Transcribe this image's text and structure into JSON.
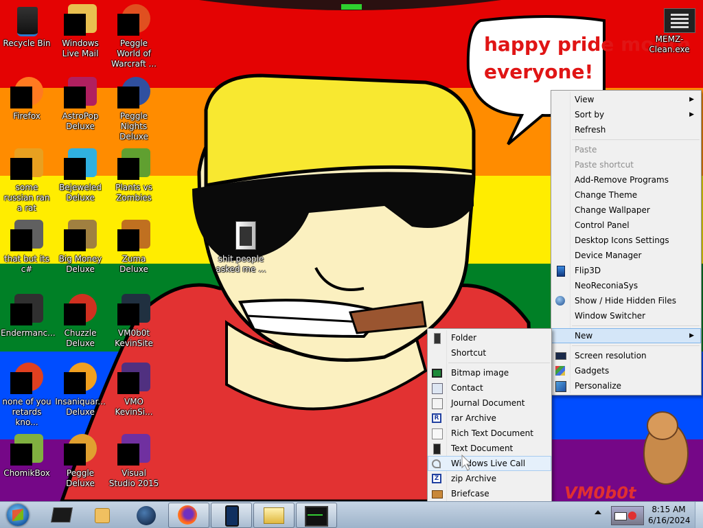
{
  "desktop": {
    "icons": [
      {
        "label": "Recycle Bin"
      },
      {
        "label": "Windows Live Mail"
      },
      {
        "label": "Peggle World of Warcraft ..."
      },
      {
        "label": "Firefox"
      },
      {
        "label": "AstroPop Deluxe"
      },
      {
        "label": "Peggle Nights Deluxe"
      },
      {
        "label": "some russian ran a rat"
      },
      {
        "label": "Bejeweled Deluxe"
      },
      {
        "label": "Plants vs Zombies"
      },
      {
        "label": "that but its c#"
      },
      {
        "label": "Big Money Deluxe"
      },
      {
        "label": "Zuma Deluxe"
      },
      {
        "label": "Endermanc..."
      },
      {
        "label": "Chuzzle Deluxe"
      },
      {
        "label": "VM0b0t KevinSite"
      },
      {
        "label": "none of you retards kno..."
      },
      {
        "label": "Insaniquar... Deluxe"
      },
      {
        "label": "VMO KevinSi..."
      },
      {
        "label": "ChomikBox"
      },
      {
        "label": "Peggle Deluxe"
      },
      {
        "label": "Visual Studio 2015"
      },
      {
        "label": "shit people asked me ..."
      },
      {
        "label": "MEMZ-Clean.exe"
      }
    ]
  },
  "wallpaper": {
    "speech_bubble": [
      "happy pride month",
      "everyone!"
    ],
    "signature": "VM0b0t",
    "colors": {
      "red": "#e40303",
      "orange": "#ff8c00",
      "yellow": "#ffed00",
      "green": "#008026",
      "blue": "#004dff",
      "purple": "#750787"
    }
  },
  "context_menu": {
    "items": [
      {
        "label": "View",
        "submenu": true
      },
      {
        "label": "Sort by",
        "submenu": true
      },
      {
        "label": "Refresh"
      },
      {
        "label": "Paste",
        "disabled": true
      },
      {
        "label": "Paste shortcut",
        "disabled": true
      },
      {
        "label": "Add-Remove Programs"
      },
      {
        "label": "Change Theme"
      },
      {
        "label": "Change Wallpaper"
      },
      {
        "label": "Control Panel"
      },
      {
        "label": "Desktop Icons Settings"
      },
      {
        "label": "Device Manager"
      },
      {
        "label": "Flip3D",
        "icon": "flip3d-icon"
      },
      {
        "label": "NeoReconiaSys"
      },
      {
        "label": "Show / Hide Hidden Files",
        "icon": "globe-icon"
      },
      {
        "label": "Window Switcher"
      },
      {
        "label": "New",
        "submenu": true
      },
      {
        "label": "Screen resolution",
        "icon": "monitor-icon"
      },
      {
        "label": "Gadgets",
        "icon": "gadgets-icon"
      },
      {
        "label": "Personalize",
        "icon": "personalize-icon"
      }
    ]
  },
  "new_submenu": {
    "items": [
      {
        "label": "Folder",
        "icon": "folder-icon"
      },
      {
        "label": "Shortcut"
      },
      {
        "label": "Bitmap image",
        "icon": "bitmap-icon"
      },
      {
        "label": "Contact",
        "icon": "contact-icon"
      },
      {
        "label": "Journal Document",
        "icon": "journal-icon"
      },
      {
        "label": "rar Archive",
        "icon": "rar-icon"
      },
      {
        "label": "Rich Text Document",
        "icon": "rtf-icon"
      },
      {
        "label": "Text Document",
        "icon": "text-doc-icon"
      },
      {
        "label": "Windows Live Call",
        "icon": "call-icon"
      },
      {
        "label": "zip Archive",
        "icon": "zip-icon"
      },
      {
        "label": "Briefcase",
        "icon": "briefcase-icon"
      }
    ]
  },
  "taskbar": {
    "clock_time": "8:15 AM",
    "clock_date": "6/16/2024"
  }
}
